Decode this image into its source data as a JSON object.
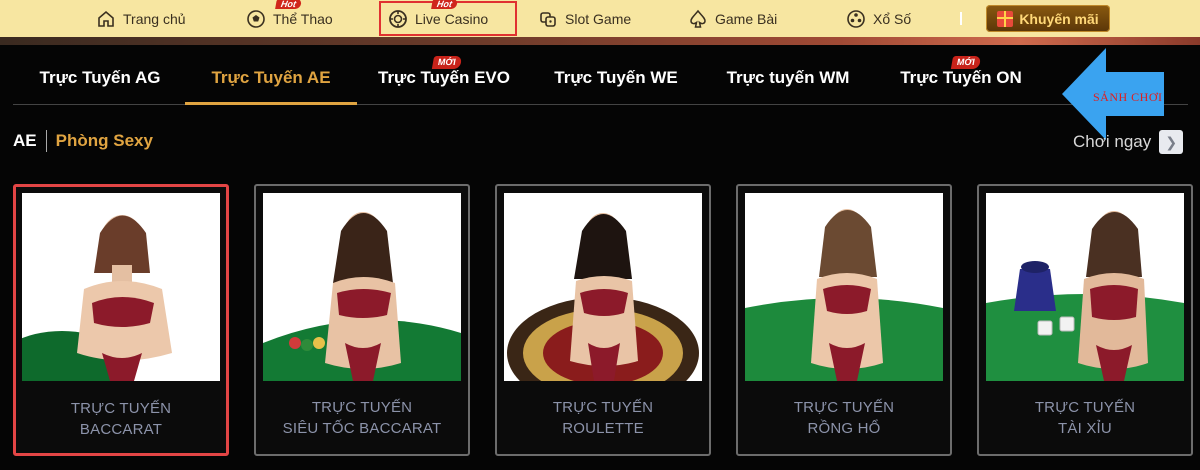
{
  "nav": {
    "items": [
      {
        "label": "Trang chủ",
        "icon": "home-icon"
      },
      {
        "label": "Thể Thao",
        "icon": "soccer-ball-icon",
        "badge": "Hot"
      },
      {
        "label": "Live Casino",
        "icon": "casino-chip-icon",
        "badge": "Hot"
      },
      {
        "label": "Slot Game",
        "icon": "slot-game-icon"
      },
      {
        "label": "Game Bài",
        "icon": "spade-icon"
      },
      {
        "label": "Xổ Số",
        "icon": "lottery-ball-icon"
      }
    ],
    "promo_label": "Khuyến mãi"
  },
  "tabs": [
    {
      "label": "Trực Tuyến AG"
    },
    {
      "label": "Trực Tuyến AE",
      "active": true
    },
    {
      "label": "Trực Tuyến EVO",
      "badge": "MỚI"
    },
    {
      "label": "Trực Tuyến WE"
    },
    {
      "label": "Trực tuyến WM"
    },
    {
      "label": "Trực Tuyến ON",
      "badge": "MỚI"
    }
  ],
  "annotation": {
    "arrow_text": "SẢNH CHƠI",
    "arrow_color": "#3aa3f0"
  },
  "breadcrumb": {
    "root": "AE",
    "room": "Phòng Sexy"
  },
  "play_now": "Chơi ngay",
  "cards": [
    {
      "line1": "TRỰC TUYẾN",
      "line2": "BACCARAT",
      "selected": true
    },
    {
      "line1": "TRỰC TUYẾN",
      "line2": "SIÊU TỐC BACCARAT"
    },
    {
      "line1": "TRỰC TUYẾN",
      "line2": "ROULETTE"
    },
    {
      "line1": "TRỰC TUYẾN",
      "line2": "RỒNG HỔ"
    },
    {
      "line1": "TRỰC TUYẾN",
      "line2": "TÀI XỈU"
    }
  ],
  "colors": {
    "accent": "#e0a441",
    "nav_bg": "#f7e6a1",
    "selected_border": "#e34545",
    "caption": "#8c93aa"
  }
}
